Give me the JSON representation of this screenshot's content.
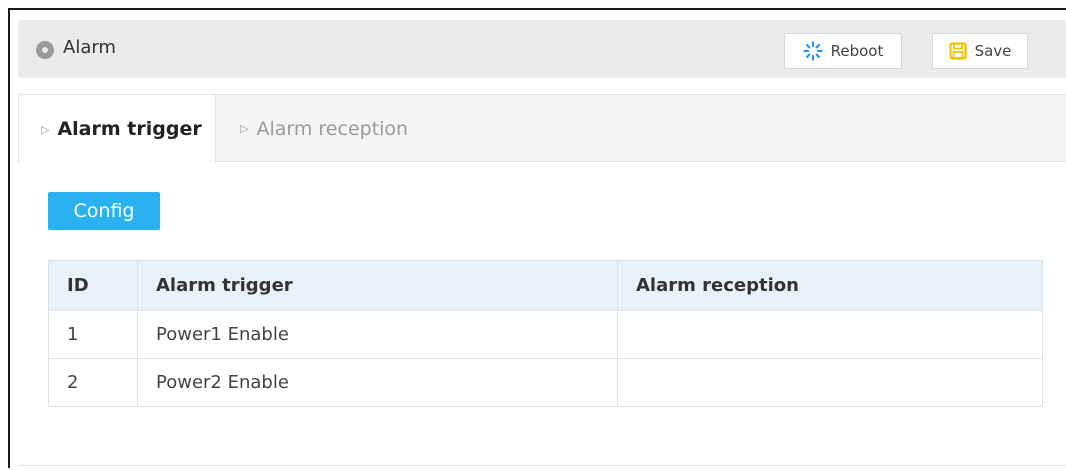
{
  "header": {
    "title": "Alarm",
    "reboot_label": "Reboot",
    "save_label": "Save"
  },
  "tabs": [
    {
      "label": "Alarm trigger",
      "active": true
    },
    {
      "label": "Alarm reception",
      "active": false
    }
  ],
  "config_label": "Config",
  "table": {
    "columns": [
      "ID",
      "Alarm trigger",
      "Alarm reception"
    ],
    "rows": [
      {
        "id": "1",
        "trigger": "Power1 Enable",
        "reception": ""
      },
      {
        "id": "2",
        "trigger": "Power2 Enable",
        "reception": ""
      }
    ]
  },
  "colors": {
    "accent": "#2ab1f0",
    "header_bg": "#e9f2fa",
    "save_icon": "#f2c200",
    "reboot_icon": "#2196f3"
  }
}
